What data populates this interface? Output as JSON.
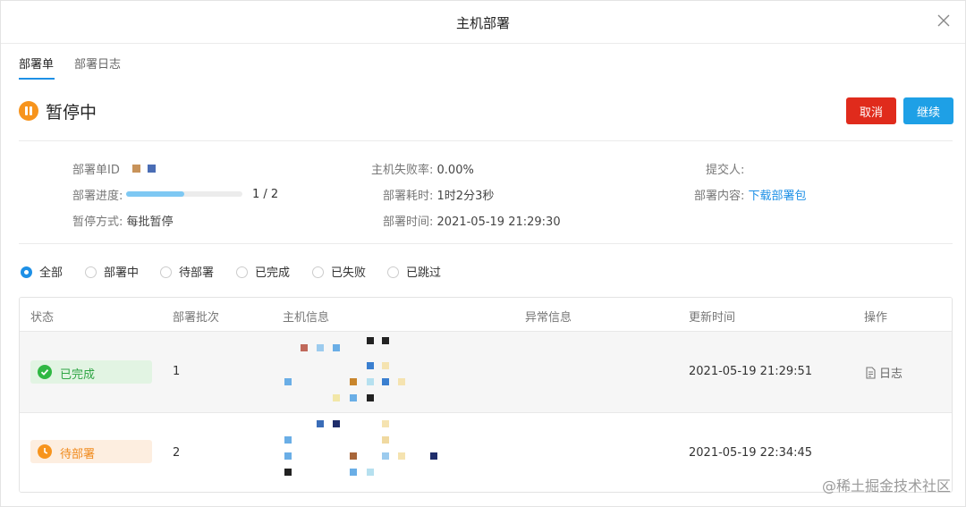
{
  "dialog": {
    "title": "主机部署"
  },
  "tabs": [
    {
      "label": "部署单"
    },
    {
      "label": "部署日志"
    }
  ],
  "status": {
    "text": "暂停中"
  },
  "actions": {
    "cancel": "取消",
    "continue": "继续"
  },
  "info": {
    "order_label": "部署单ID",
    "fail_rate_label": "主机失败率:",
    "fail_rate_value": "0.00%",
    "submitter_label": "提交人:",
    "progress_label": "部署进度:",
    "progress_text": "1 / 2",
    "progress_fraction": 0.5,
    "duration_label": "部署耗时:",
    "duration_value": "1时2分3秒",
    "content_label": "部署内容:",
    "content_link": "下载部署包",
    "pause_mode_label": "暂停方式:",
    "pause_mode_value": "每批暂停",
    "time_label": "部署时间:",
    "time_value": "2021-05-19 21:29:30"
  },
  "filters": [
    {
      "label": "全部",
      "checked": true
    },
    {
      "label": "部署中",
      "checked": false
    },
    {
      "label": "待部署",
      "checked": false
    },
    {
      "label": "已完成",
      "checked": false
    },
    {
      "label": "已失败",
      "checked": false
    },
    {
      "label": "已跳过",
      "checked": false
    }
  ],
  "table": {
    "headers": [
      "状态",
      "部署批次",
      "主机信息",
      "异常信息",
      "更新时间",
      "操作"
    ],
    "rows": [
      {
        "status": "已完成",
        "status_icon": "check-circle-icon",
        "batch": "1",
        "updated": "2021-05-19 21:29:51",
        "action": "日志"
      },
      {
        "status": "待部署",
        "status_icon": "clock-icon",
        "batch": "2",
        "updated": "2021-05-19 22:34:45",
        "action": ""
      }
    ]
  },
  "colors": {
    "primary": "#1e90e6",
    "danger": "#e02b1c",
    "warning": "#f7941d",
    "success": "#2fb843"
  },
  "watermark": "@稀土掘金技术社区"
}
